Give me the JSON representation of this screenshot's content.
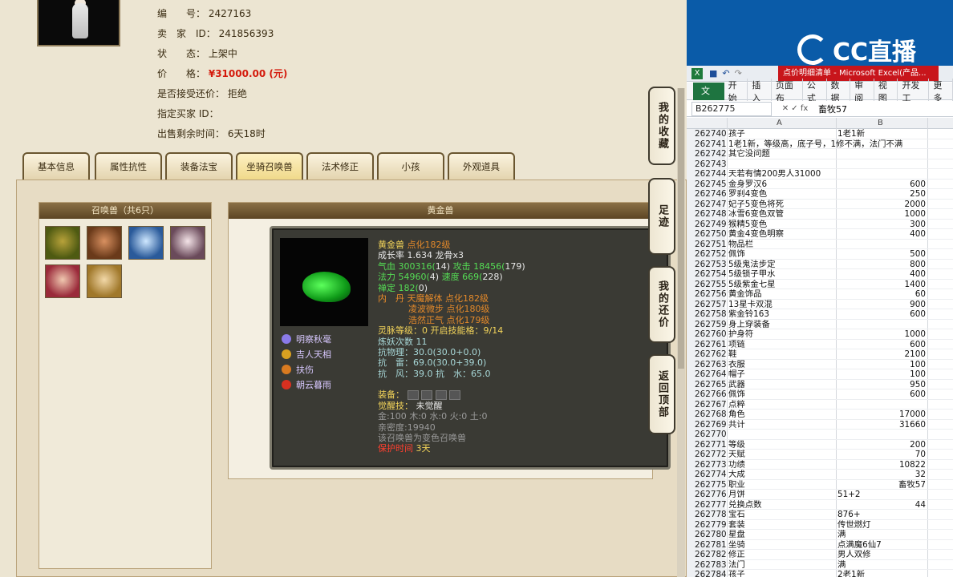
{
  "listing": {
    "id_label": "编　　号：",
    "id_value": "2427163",
    "seller_label": "卖　家　ID：",
    "seller_value": "241856393",
    "status_label": "状　　态：",
    "status_value": "上架中",
    "price_label": "价　　格：",
    "price_value": "¥31000.00 (元)",
    "bargain_label": "是否接受还价：",
    "bargain_value": "拒绝",
    "buyer_label": "指定买家 ID：",
    "buyer_value": "",
    "remain_label": "出售剩余时间：",
    "remain_value": "6天18时"
  },
  "tabs": [
    {
      "label": "基本信息"
    },
    {
      "label": "属性抗性"
    },
    {
      "label": "装备法宝"
    },
    {
      "label": "坐骑召唤兽"
    },
    {
      "label": "法术修正"
    },
    {
      "label": "小孩"
    },
    {
      "label": "外观道具"
    }
  ],
  "summon": {
    "title": "召唤兽（共6只）"
  },
  "pet": {
    "panel_title": "黄金兽",
    "name": "黄金兽",
    "name_extra": "点化182级",
    "growth": "成长率 1.634 龙骨x3",
    "hp_label": "气血",
    "hp": "300316(",
    "hp_n": "14)",
    "atk_label": "攻击",
    "atk": "18456(",
    "atk_n": "179)",
    "mp_label": "法力",
    "mp": "54960(",
    "mp_n": "4)",
    "spd_label": "速度",
    "spd": "669(",
    "spd_n": "228)",
    "zen_label": "禅定",
    "zen": "182(",
    "zen_n": "0)",
    "neidan_1": "内　丹 天魔解体 点化182级",
    "neidan_2": "凌波微步 点化180级",
    "neidan_3": "浩然正气 点化179级",
    "spirit": "灵脉等级：0 开启技能格：9/14",
    "refine": "炼妖次数 11",
    "res_phys": "抗物理：30.0(30.0+0.0)",
    "res_thunder": "抗　雷：69.0(30.0+39.0)",
    "res_wind": "抗　风：39.0 抗　水：65.0",
    "equip_label": "装备：",
    "awaken_label": "觉醒技：",
    "awaken_value": "未觉醒",
    "elements": "金:100 木:0 水:0 火:0 土:0",
    "intimacy": "亲密度:19940",
    "variant": "该召唤兽为变色召唤兽",
    "protect_label": "保护时间",
    "protect_value": "3天",
    "skills": [
      {
        "name": "明察秋毫",
        "color": "#8a7ae8"
      },
      {
        "name": "吉人天相",
        "color": "#d8a020"
      },
      {
        "name": "扶伤",
        "color": "#d87a20"
      },
      {
        "name": "朝云暮雨",
        "color": "#d83020"
      }
    ]
  },
  "side_tabs": [
    {
      "label": "我的收藏"
    },
    {
      "label": "足迹"
    },
    {
      "label": "我的还价"
    },
    {
      "label": "返回顶部"
    }
  ],
  "excel": {
    "brand": "CC直播",
    "title": "点价明细清单 - Microsoft Excel(产品...",
    "ribbon": [
      "开始",
      "插入",
      "页面布",
      "公式",
      "数据",
      "审阅",
      "视图",
      "开发工",
      "更多"
    ],
    "file_tab": "文件",
    "name_box": "B262775",
    "formula": "畜牧57",
    "col_a": "A",
    "col_b": "B",
    "rows": [
      [
        "262740",
        "孩子",
        "1老1新",
        false
      ],
      [
        "262741",
        "1老1新，等级高，底子号，1修不满，法门不满",
        "",
        false
      ],
      [
        "262742",
        "其它没问题",
        "",
        false
      ],
      [
        "262743",
        "",
        "",
        false
      ],
      [
        "262744",
        "天若有情200男人31000",
        "",
        false
      ],
      [
        "262745",
        "金身罗汉6",
        "600",
        true
      ],
      [
        "262746",
        "罗刹4变色",
        "250",
        true
      ],
      [
        "262747",
        "妃子5变色将死",
        "2000",
        true
      ],
      [
        "262748",
        "冰雪6变色双管",
        "1000",
        true
      ],
      [
        "262749",
        "猴精5变色",
        "300",
        true
      ],
      [
        "262750",
        "黄金4变色明察",
        "400",
        true
      ],
      [
        "262751",
        "物品栏",
        "",
        false
      ],
      [
        "262752",
        "佩饰",
        "500",
        true
      ],
      [
        "262753",
        "5级鬼法步定",
        "800",
        true
      ],
      [
        "262754",
        "5级锁子甲水",
        "400",
        true
      ],
      [
        "262755",
        "5级紫金七星",
        "1400",
        true
      ],
      [
        "262756",
        "黄金饰品",
        "60",
        true
      ],
      [
        "262757",
        "13星卡双混",
        "900",
        true
      ],
      [
        "262758",
        "紫金铃163",
        "600",
        true
      ],
      [
        "262759",
        "身上穿装备",
        "",
        false
      ],
      [
        "262760",
        "护身符",
        "1000",
        true
      ],
      [
        "262761",
        "项链",
        "600",
        true
      ],
      [
        "262762",
        "鞋",
        "2100",
        true
      ],
      [
        "262763",
        "衣服",
        "100",
        true
      ],
      [
        "262764",
        "帽子",
        "100",
        true
      ],
      [
        "262765",
        "武器",
        "950",
        true
      ],
      [
        "262766",
        "佩饰",
        "600",
        true
      ],
      [
        "262767",
        "点粹",
        "",
        false
      ],
      [
        "262768",
        "角色",
        "17000",
        true
      ],
      [
        "262769",
        "共计",
        "31660",
        true
      ],
      [
        "262770",
        "",
        "",
        false
      ],
      [
        "262771",
        "等级",
        "200",
        true
      ],
      [
        "262772",
        "天赋",
        "70",
        true
      ],
      [
        "262773",
        "功绩",
        "10822",
        true
      ],
      [
        "262774",
        "大成",
        "32",
        true
      ],
      [
        "262775",
        "职业",
        "畜牧57",
        true
      ],
      [
        "262776",
        "月饼",
        "51+2",
        false
      ],
      [
        "262777",
        "兑换点数",
        "44",
        true
      ],
      [
        "262778",
        "宝石",
        "876+",
        false
      ],
      [
        "262779",
        "套装",
        "传世燃灯",
        false
      ],
      [
        "262780",
        "星盘",
        "满",
        false
      ],
      [
        "262781",
        "坐骑",
        "点满魔6仙7",
        false
      ],
      [
        "262782",
        "修正",
        "男人双修",
        false
      ],
      [
        "262783",
        "法门",
        "满",
        false
      ],
      [
        "262784",
        "孩子",
        "2老1新",
        false
      ]
    ]
  }
}
